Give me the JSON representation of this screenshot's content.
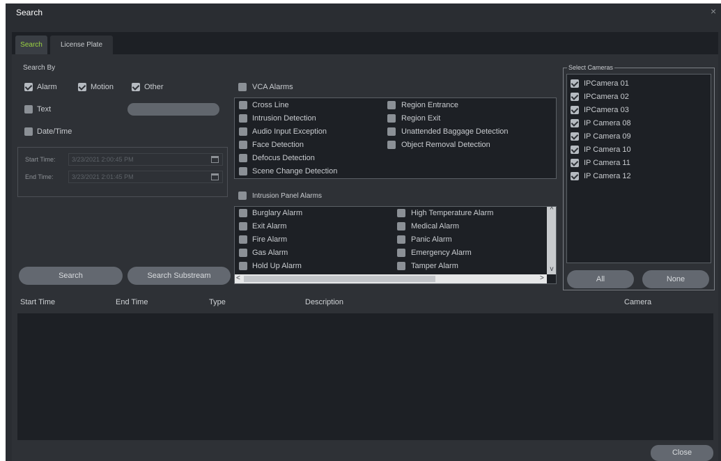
{
  "window": {
    "title": "Search",
    "close_glyph": "×"
  },
  "tabs": [
    "Search",
    "License Plate"
  ],
  "search_by": {
    "label": "Search By",
    "alarm": "Alarm",
    "motion": "Motion",
    "other": "Other",
    "text": "Text",
    "datetime": "Date/Time"
  },
  "dates": {
    "start_label": "Start Time:",
    "start_value": "3/23/2021 2:00:45 PM",
    "end_label": "End Time:",
    "end_value": "3/23/2021 2:01:45 PM"
  },
  "vca": {
    "header": "VCA Alarms",
    "items": [
      "Cross Line",
      "Intrusion Detection",
      "Audio Input Exception",
      "Face Detection",
      "Defocus Detection",
      "Scene Change Detection",
      "Region Entrance",
      "Region Exit",
      "Unattended Baggage Detection",
      "Object Removal Detection"
    ]
  },
  "intrusion": {
    "header": "Intrusion Panel Alarms",
    "items": [
      "Burglary Alarm",
      "Exit Alarm",
      "Fire Alarm",
      "Gas Alarm",
      "Hold Up Alarm",
      "High Temperature Alarm",
      "Medical Alarm",
      "Panic Alarm",
      "Emergency Alarm",
      "Tamper Alarm"
    ]
  },
  "cameras": {
    "legend": "Select Cameras",
    "items": [
      "IPCamera 01",
      "IPCamera 02",
      "IPCamera 03",
      "IP Camera 08",
      "IP Camera 09",
      "IP Camera 10",
      "IP Camera 11",
      "IP Camera 12"
    ],
    "all": "All",
    "none": "None"
  },
  "buttons": {
    "search": "Search",
    "substream": "Search Substream",
    "close": "Close"
  },
  "results": {
    "columns": [
      "Start Time",
      "End Time",
      "Type",
      "Description",
      "Camera"
    ]
  },
  "scroll": {
    "up": "^",
    "down": "v",
    "left": "<",
    "right": ">"
  }
}
